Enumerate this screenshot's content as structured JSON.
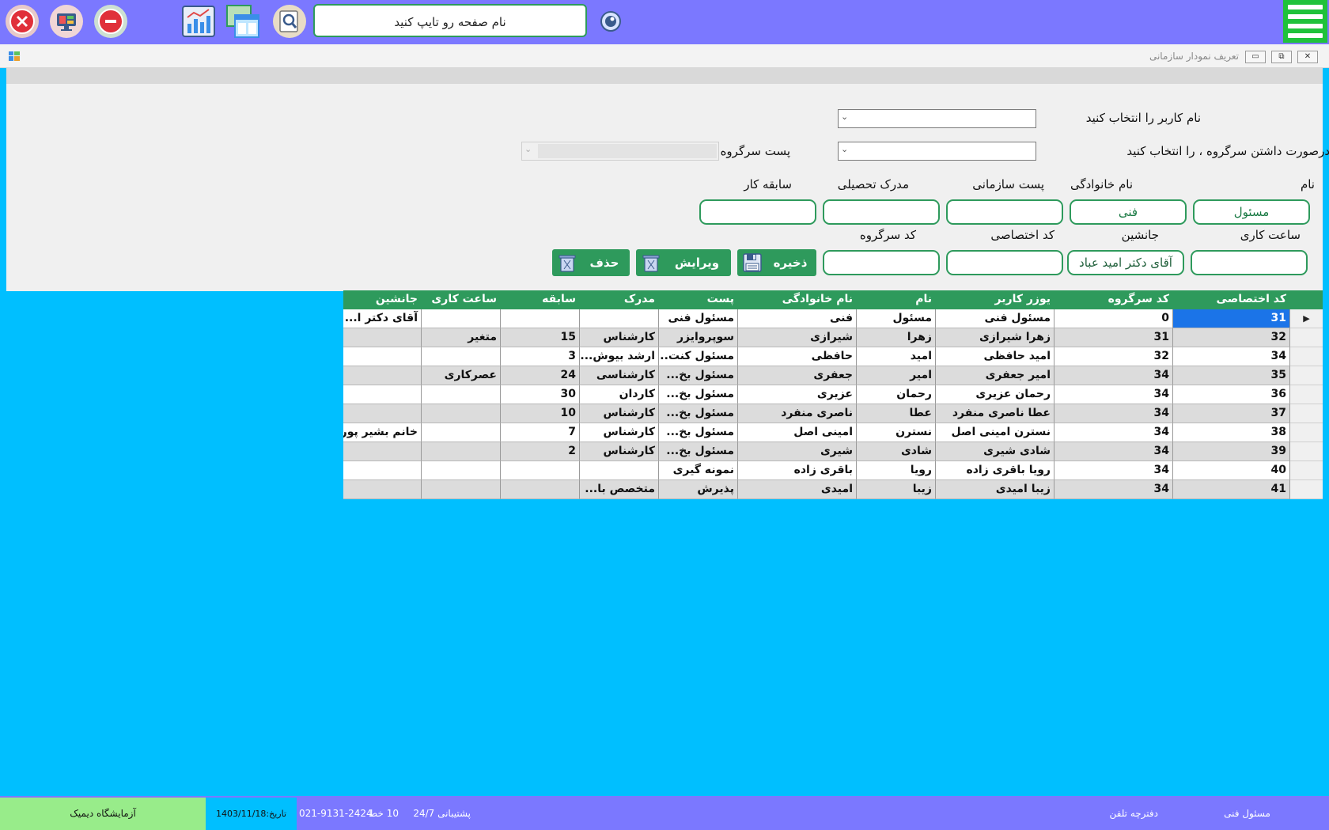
{
  "topbar": {
    "search_placeholder": "نام صفحه رو تایپ کنید",
    "buttons": [
      "close-icon",
      "monitor-icon",
      "minus-icon",
      "report-chart-icon",
      "windows-icon",
      "magnifier-icon",
      "eye-icon",
      "hamburger-menu-icon"
    ]
  },
  "window": {
    "title": "تعریف نمودار سازمانی",
    "controls": {
      "minimize": "▭",
      "restore": "⧉",
      "close": "✕"
    }
  },
  "form": {
    "user_label": "نام کاربر را انتخاب کنید",
    "supervisor_label": "درصورت داشتن سرگروه ، را انتخاب کنید",
    "supervisor_post_label": "پست سرگروه",
    "first_name_label": "نام",
    "last_name_label": "نام خانوادگی",
    "org_post_label": "پست سازمانی",
    "education_label": "مدرک تحصیلی",
    "experience_label": "سابقه کار",
    "work_hours_label": "ساعت کاری",
    "substitute_label": "جانشین",
    "personal_code_label": "کد اختصاصی",
    "supervisor_code_label": "کد سرگروه",
    "first_name_value": "مسئول",
    "last_name_value": "فنی",
    "org_post_value": "",
    "education_value": "",
    "experience_value": "",
    "work_hours_value": "",
    "substitute_value": "آقای دکتر امید عباد",
    "personal_code_value": "",
    "supervisor_code_value": "",
    "save_label": "ذخیره",
    "edit_label": "ویرایش",
    "delete_label": "حذف"
  },
  "grid": {
    "columns": [
      "کد اختصاصی",
      "کد سرگروه",
      "یوزر کاربر",
      "نام",
      "نام خانوادگی",
      "پست",
      "مدرک",
      "سابقه",
      "ساعت کاری",
      "جانشین"
    ],
    "rows": [
      [
        "31",
        "0",
        "مسئول فنی",
        "مسئول",
        "فنی",
        "مسئول فنی",
        "",
        "",
        "",
        "آقای دکتر ا..."
      ],
      [
        "32",
        "31",
        "زهرا شیرازی",
        "زهرا",
        "شیرازی",
        "سوپروایزر",
        "کارشناس",
        "15",
        "متغیر",
        ""
      ],
      [
        "34",
        "32",
        "امید حافظی",
        "امید",
        "حافظی",
        "مسئول کنت...",
        "ارشد بیوش...",
        "3",
        "",
        ""
      ],
      [
        "35",
        "34",
        "امیر جعفری",
        "امیر",
        "جعفری",
        "مسئول بخ...",
        "کارشناسی",
        "24",
        "عصرکاری",
        ""
      ],
      [
        "36",
        "34",
        "رحمان عزیری",
        "رحمان",
        "عزیری",
        "مسئول بخ...",
        "کاردان",
        "30",
        "",
        ""
      ],
      [
        "37",
        "34",
        "عطا ناصری منفرد",
        "عطا",
        "ناصری منفرد",
        "مسئول بخ...",
        "کارشناس",
        "10",
        "",
        ""
      ],
      [
        "38",
        "34",
        "نسترن امینی اصل",
        "نسترن",
        "امینی اصل",
        "مسئول بخ...",
        "کارشناس",
        "7",
        "",
        "خانم بشیر پور"
      ],
      [
        "39",
        "34",
        "شادی شیری",
        "شادی",
        "شیری",
        "مسئول بخ...",
        "کارشناس",
        "2",
        "",
        ""
      ],
      [
        "40",
        "34",
        "رویا  باقری زاده",
        "رویا",
        "باقری زاده",
        "نمونه گیری",
        "",
        "",
        "",
        ""
      ],
      [
        "41",
        "34",
        "زیبا امیدی",
        "زیبا",
        "امیدی",
        "پذیرش",
        "متخصص با...",
        "",
        "",
        ""
      ]
    ]
  },
  "status": {
    "user": "مسئول فنی",
    "phonebook": "دفترچه تلفن",
    "support": "پشتیبانی 24/7",
    "lines": "10  خط",
    "phone": "021-9131-2424",
    "date": "تاریخ:1403/11/18",
    "lab": "آزمایشگاه دیمیک"
  },
  "colors": {
    "accent": "#2e9a5c",
    "topbar": "#7b78ff",
    "workspace": "#00bfff",
    "status_green": "#98ec8a"
  }
}
